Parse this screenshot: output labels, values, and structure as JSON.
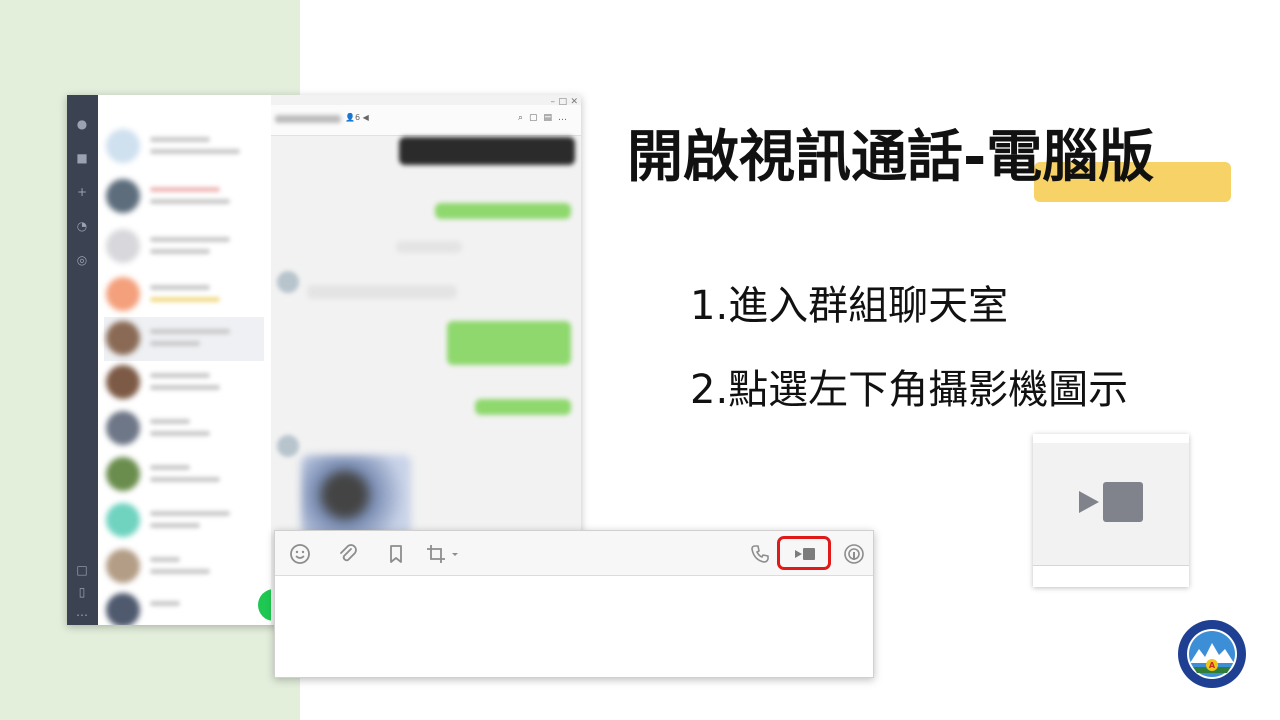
{
  "slide": {
    "title_main": "開啟視訊通話-",
    "title_highlight": "電腦版",
    "steps": [
      "1.進入群組聊天室",
      "2.點選左下角攝影機圖示"
    ]
  },
  "app": {
    "member_count": "6",
    "window_controls": [
      "–",
      "□",
      "✕"
    ]
  },
  "colors": {
    "band": "#e3eedb",
    "highlight": "#f7d266",
    "red_box": "#e01919",
    "green": "#1ec852",
    "rail": "#3b4252"
  },
  "icons": {
    "toolbar_left": [
      "emoji-icon",
      "attach-icon",
      "bookmark-icon",
      "crop-icon"
    ],
    "toolbar_right": [
      "phone-icon",
      "video-camera-icon",
      "livestream-icon"
    ]
  }
}
